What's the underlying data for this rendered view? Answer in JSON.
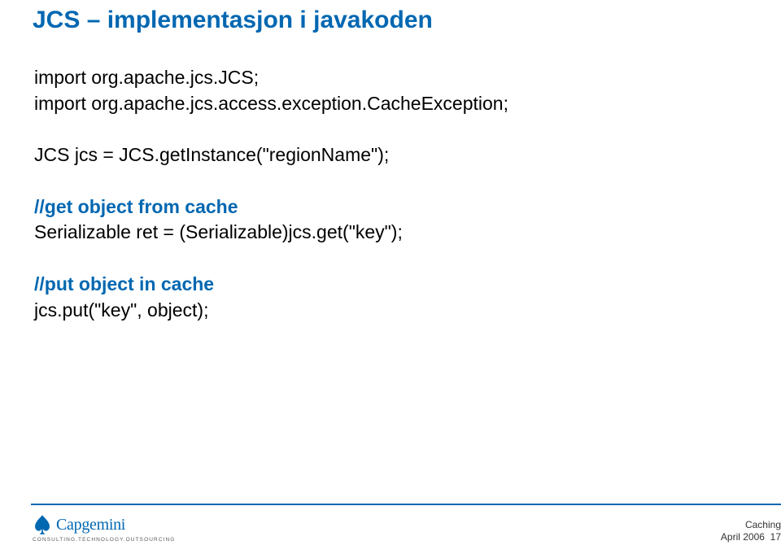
{
  "slide": {
    "title": "JCS – implementasjon i javakoden",
    "code": {
      "import1": "import org.apache.jcs.JCS;",
      "import2": "import org.apache.jcs.access.exception.CacheException;",
      "instance": "JCS jcs = JCS.getInstance(\"regionName\");",
      "comment_get": "//get object from cache",
      "get_line": "Serializable ret = (Serializable)jcs.get(\"key\");",
      "comment_put": "//put object in cache",
      "put_line": "jcs.put(\"key\", object);"
    }
  },
  "footer": {
    "logo_name": "Capgemini",
    "logo_tagline": "CONSULTING.TECHNOLOGY.OUTSOURCING",
    "right_label": "Caching",
    "date": "April 2006",
    "page": "17"
  }
}
